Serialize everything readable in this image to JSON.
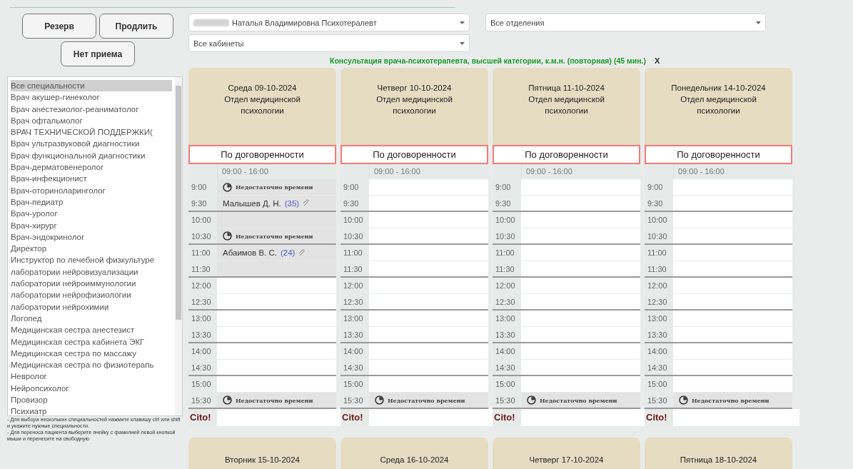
{
  "buttons": [
    {
      "label": "Резерв"
    },
    {
      "label": "Продлить"
    },
    {
      "label": "Нет приема"
    }
  ],
  "filters": {
    "doctor": "Наталья Владимировна Психотералевт",
    "department": "Все отделения",
    "cabinet": "Все кабинеты"
  },
  "service": {
    "text": "Консультация врача-психотерапевта, высшей категории, к.м.н. (повторная) (45 мин.)",
    "close": "X"
  },
  "specialties": [
    {
      "label": "Все специальности",
      "selected": true
    },
    {
      "label": "Врач акушер-гинеколог",
      "selected": false
    },
    {
      "label": "Врач анестезиолог-реаниматолог",
      "selected": false
    },
    {
      "label": "Врач офтальмолог",
      "selected": false
    },
    {
      "label": "ВРАЧ ТЕХНИЧЕСКОЙ ПОДДЕРЖКИ(",
      "selected": false
    },
    {
      "label": "Врач ультразвуковой диагностики",
      "selected": false
    },
    {
      "label": "Врач функциональной диагностики",
      "selected": false
    },
    {
      "label": "Врач-дерматовенеролог",
      "selected": false
    },
    {
      "label": "Врач-инфекционист",
      "selected": false
    },
    {
      "label": "Врач-оториноларинголог",
      "selected": false
    },
    {
      "label": "Врач-педиатр",
      "selected": false
    },
    {
      "label": "Врач-уролог",
      "selected": false
    },
    {
      "label": "Врач-хирург",
      "selected": false
    },
    {
      "label": "Врач-эндокринолог",
      "selected": false
    },
    {
      "label": "Директор",
      "selected": false
    },
    {
      "label": "Инструктор по лечебной физкультуре",
      "selected": false
    },
    {
      "label": "лаборатории нейровизуализации",
      "selected": false
    },
    {
      "label": "лаборатории нейроиммунологии",
      "selected": false
    },
    {
      "label": "лаборатории нейрофизиологии",
      "selected": false
    },
    {
      "label": "лаборатории нейрохимии",
      "selected": false
    },
    {
      "label": "Логопед",
      "selected": false
    },
    {
      "label": "Медицинская сестра анестезист",
      "selected": false
    },
    {
      "label": "Медицинская сестра кабинета ЭКГ",
      "selected": false
    },
    {
      "label": "Медицинская сестра по массажу",
      "selected": false
    },
    {
      "label": "Медицинская сестра по физиотерапь",
      "selected": false
    },
    {
      "label": "Невролог",
      "selected": false
    },
    {
      "label": "Нейропсихолог",
      "selected": false
    },
    {
      "label": "Провизор",
      "selected": false
    },
    {
      "label": "Психиатр",
      "selected": false
    }
  ],
  "notes": [
    "- Для выбора нескольких специальностей нажмите клавишу ctrl или shift и укажите нужные специальности.",
    "- Для переноса пациента выберите ячейку с фамилией левой кнопкой мыши и перенесите на свободную"
  ],
  "days": [
    {
      "title": "Среда 09-10-2024",
      "department": "Отдел медицинской психологии",
      "mode": "По договоренности",
      "hours": "09:00 - 16:00",
      "cito": "Cito!",
      "slots": [
        {
          "time": "9:00",
          "kind": "blocked",
          "text": "Недостаточно времени"
        },
        {
          "time": "9:30",
          "kind": "patient",
          "text": "Малышев Д. Н.",
          "count": "(35)"
        },
        {
          "time": "10:00",
          "kind": "busy"
        },
        {
          "time": "10:30",
          "kind": "blocked",
          "text": "Недостаточно времени"
        },
        {
          "time": "11:00",
          "kind": "patient",
          "text": "Абаимов В. С.",
          "count": "(24)"
        },
        {
          "time": "11:30",
          "kind": "busy"
        },
        {
          "time": "12:00",
          "kind": "free"
        },
        {
          "time": "12:30",
          "kind": "free"
        },
        {
          "time": "13:00",
          "kind": "free"
        },
        {
          "time": "13:30",
          "kind": "free"
        },
        {
          "time": "14:00",
          "kind": "free"
        },
        {
          "time": "14:30",
          "kind": "free"
        },
        {
          "time": "15:00",
          "kind": "free"
        },
        {
          "time": "15:30",
          "kind": "blocked",
          "text": "Недостаточно времени"
        }
      ]
    },
    {
      "title": "Четверг 10-10-2024",
      "department": "Отдел медицинской психологии",
      "mode": "По договоренности",
      "hours": "09:00 - 16:00",
      "cito": "Cito!",
      "slots": [
        {
          "time": "9:00",
          "kind": "free"
        },
        {
          "time": "9:30",
          "kind": "free"
        },
        {
          "time": "10:00",
          "kind": "free"
        },
        {
          "time": "10:30",
          "kind": "free"
        },
        {
          "time": "11:00",
          "kind": "free"
        },
        {
          "time": "11:30",
          "kind": "free"
        },
        {
          "time": "12:00",
          "kind": "free"
        },
        {
          "time": "12:30",
          "kind": "free"
        },
        {
          "time": "13:00",
          "kind": "free"
        },
        {
          "time": "13:30",
          "kind": "free"
        },
        {
          "time": "14:00",
          "kind": "free"
        },
        {
          "time": "14:30",
          "kind": "free"
        },
        {
          "time": "15:00",
          "kind": "free"
        },
        {
          "time": "15:30",
          "kind": "blocked",
          "text": "Недостаточно времени"
        }
      ]
    },
    {
      "title": "Пятница 11-10-2024",
      "department": "Отдел медицинской психологии",
      "mode": "По договоренности",
      "hours": "09:00 - 16:00",
      "cito": "Cito!",
      "slots": [
        {
          "time": "9:00",
          "kind": "free"
        },
        {
          "time": "9:30",
          "kind": "free"
        },
        {
          "time": "10:00",
          "kind": "free"
        },
        {
          "time": "10:30",
          "kind": "free"
        },
        {
          "time": "11:00",
          "kind": "free"
        },
        {
          "time": "11:30",
          "kind": "free"
        },
        {
          "time": "12:00",
          "kind": "free"
        },
        {
          "time": "12:30",
          "kind": "free"
        },
        {
          "time": "13:00",
          "kind": "free"
        },
        {
          "time": "13:30",
          "kind": "free"
        },
        {
          "time": "14:00",
          "kind": "free"
        },
        {
          "time": "14:30",
          "kind": "free"
        },
        {
          "time": "15:00",
          "kind": "free"
        },
        {
          "time": "15:30",
          "kind": "blocked",
          "text": "Недостаточно времени"
        }
      ]
    },
    {
      "title": "Понедельник 14-10-2024",
      "department": "Отдел медицинской психологии",
      "mode": "По договоренности",
      "hours": "09:00 - 16:00",
      "cito": "Cito!",
      "slots": [
        {
          "time": "9:00",
          "kind": "free"
        },
        {
          "time": "9:30",
          "kind": "free"
        },
        {
          "time": "10:00",
          "kind": "free"
        },
        {
          "time": "10:30",
          "kind": "free"
        },
        {
          "time": "11:00",
          "kind": "free"
        },
        {
          "time": "11:30",
          "kind": "free"
        },
        {
          "time": "12:00",
          "kind": "free"
        },
        {
          "time": "12:30",
          "kind": "free"
        },
        {
          "time": "13:00",
          "kind": "free"
        },
        {
          "time": "13:30",
          "kind": "free"
        },
        {
          "time": "14:00",
          "kind": "free"
        },
        {
          "time": "14:30",
          "kind": "free"
        },
        {
          "time": "15:00",
          "kind": "free"
        },
        {
          "time": "15:30",
          "kind": "blocked",
          "text": "Недостаточно времени"
        }
      ]
    }
  ],
  "next_days": [
    {
      "title": "Вторник 15-10-2024"
    },
    {
      "title": "Среда 16-10-2024"
    },
    {
      "title": "Четверг 17-10-2024"
    },
    {
      "title": "Пятница 18-10-2024"
    }
  ]
}
